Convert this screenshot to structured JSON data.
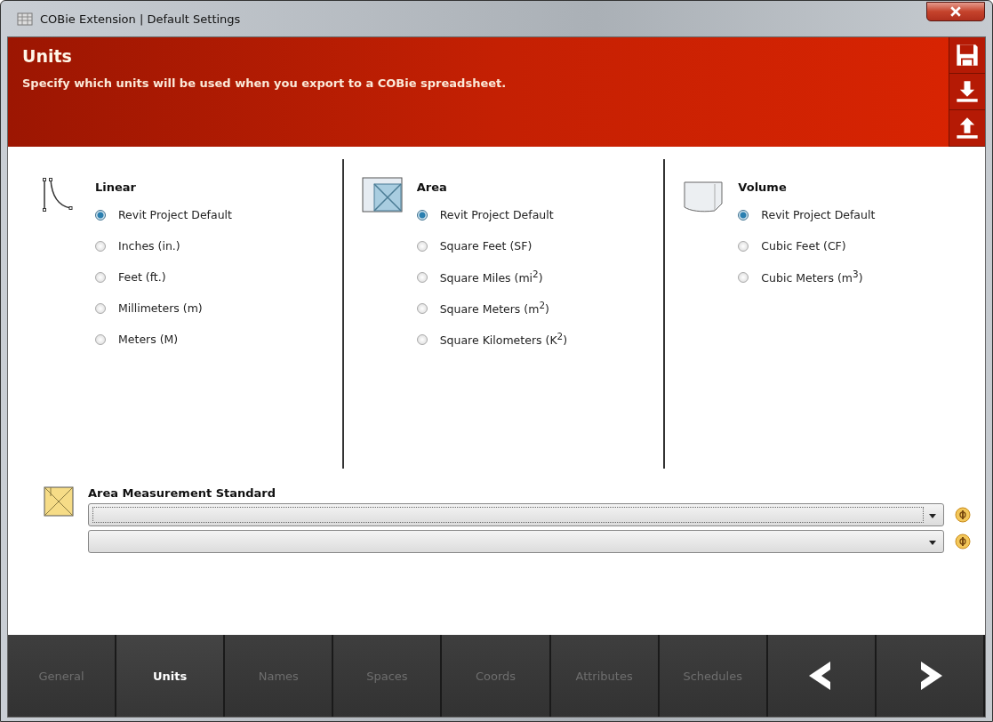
{
  "window": {
    "title": "COBie Extension | Default Settings"
  },
  "header": {
    "title": "Units",
    "subtitle": "Specify which units will be used when you export to a COBie spreadsheet."
  },
  "unit_groups": [
    {
      "kind": "linear",
      "title": "Linear",
      "options": [
        {
          "label": "Revit Project Default",
          "selected": true
        },
        {
          "label": "Inches (in.)",
          "selected": false
        },
        {
          "label": "Feet (ft.)",
          "selected": false
        },
        {
          "label": "Millimeters (m)",
          "selected": false
        },
        {
          "label": "Meters (M)",
          "selected": false
        }
      ]
    },
    {
      "kind": "area",
      "title": "Area",
      "options": [
        {
          "label": "Revit Project Default",
          "selected": true
        },
        {
          "label": "Square Feet (SF)",
          "selected": false
        },
        {
          "label": "Square Miles (mi$^{2}$)",
          "selected": false
        },
        {
          "label": "Square Meters (m$^{2}$)",
          "selected": false
        },
        {
          "label": "Square Kilometers (K$^{2}$)",
          "selected": false
        }
      ]
    },
    {
      "kind": "volume",
      "title": "Volume",
      "options": [
        {
          "label": "Revit Project Default",
          "selected": true
        },
        {
          "label": "Cubic Feet (CF)",
          "selected": false
        },
        {
          "label": "Cubic Meters (m$^{3}$)",
          "selected": false
        }
      ]
    }
  ],
  "area_measurement": {
    "title": "Area Measurement Standard",
    "dropdowns": [
      {
        "focused": true
      },
      {
        "focused": false
      }
    ]
  },
  "tabs": [
    {
      "label": "General",
      "selected": false
    },
    {
      "label": "Units",
      "selected": true
    },
    {
      "label": "Names",
      "selected": false
    },
    {
      "label": "Spaces",
      "selected": false
    },
    {
      "label": "Coords",
      "selected": false
    },
    {
      "label": "Attributes",
      "selected": false
    },
    {
      "label": "Schedules",
      "selected": false
    }
  ]
}
